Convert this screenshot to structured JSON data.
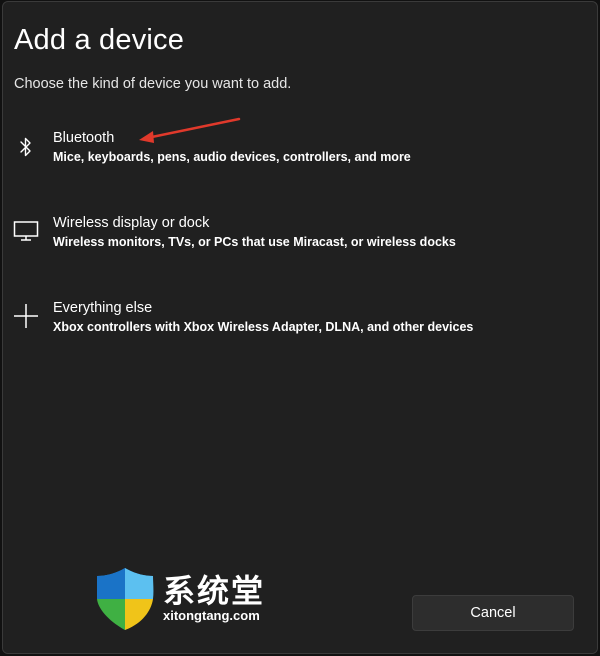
{
  "dialog": {
    "title": "Add a device",
    "subtitle": "Choose the kind of device you want to add."
  },
  "options": [
    {
      "icon": "bluetooth-icon",
      "title": "Bluetooth",
      "description": "Mice, keyboards, pens, audio devices, controllers, and more"
    },
    {
      "icon": "monitor-icon",
      "title": "Wireless display or dock",
      "description": "Wireless monitors, TVs, or PCs that use Miracast, or wireless docks"
    },
    {
      "icon": "plus-icon",
      "title": "Everything else",
      "description": "Xbox controllers with Xbox Wireless Adapter, DLNA, and other devices"
    }
  ],
  "footer": {
    "cancel_label": "Cancel"
  },
  "watermark": {
    "name": "系统堂",
    "url": "xitongtang.com"
  },
  "colors": {
    "background": "#202020",
    "text": "#ffffff",
    "arrow": "#e0392b"
  }
}
